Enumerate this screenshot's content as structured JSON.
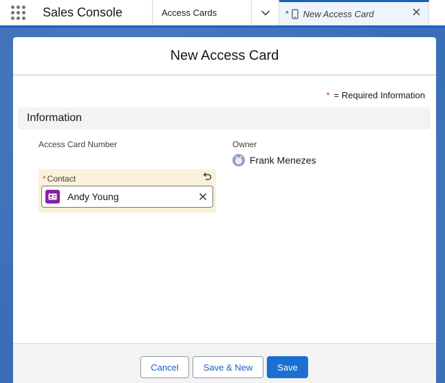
{
  "app": {
    "name": "Sales Console"
  },
  "tabs": [
    {
      "label": "Access Cards"
    },
    {
      "label": "New Access Card",
      "unsaved_marker": "*"
    }
  ],
  "modal": {
    "title": "New Access Card",
    "required_note": {
      "marker": "*",
      "text": "= Required Information"
    },
    "section": "Information",
    "fields": {
      "access_card_number_label": "Access Card Number",
      "owner_label": "Owner",
      "owner_value": "Frank Menezes",
      "contact_label": "Contact",
      "contact_required_marker": "*",
      "contact_value": "Andy Young"
    },
    "buttons": {
      "cancel": "Cancel",
      "save_new": "Save & New",
      "save": "Save"
    }
  },
  "icons": {
    "app_launcher": "waffle-icon",
    "tab_menu": "chevron-down-icon",
    "tab_type": "phone-icon",
    "tab_close": "close-icon",
    "undo": "undo-icon",
    "contact": "contact-card-icon",
    "clear": "clear-icon",
    "owner_avatar": "avatar-icon"
  },
  "colors": {
    "brand_blue": "#1b5fbd",
    "save_button": "#1b6fd1",
    "required_red": "#c23934",
    "contact_icon": "#8a1fa8",
    "edited_field_bg": "#faf1dc"
  }
}
